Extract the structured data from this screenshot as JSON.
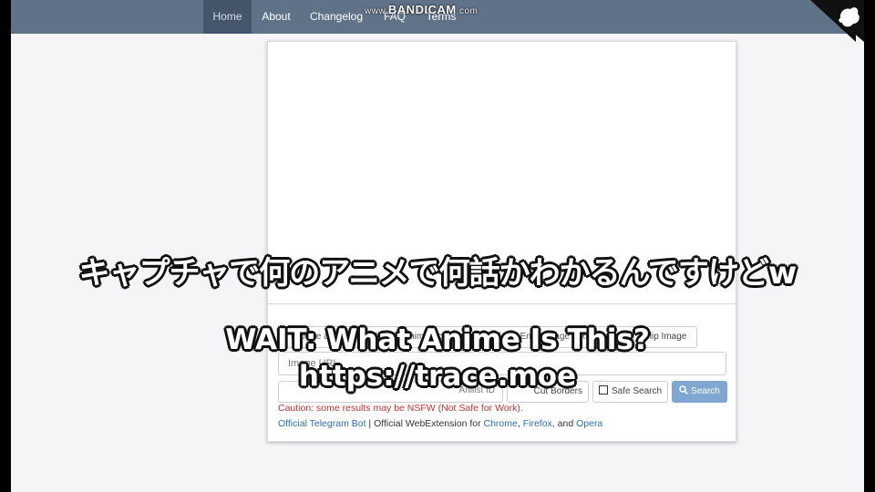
{
  "navbar": {
    "items": [
      {
        "label": "Home",
        "active": true
      },
      {
        "label": "About"
      },
      {
        "label": "Changelog"
      },
      {
        "label": "FAQ"
      },
      {
        "label": "Terms"
      }
    ]
  },
  "form": {
    "drop_button_label": "Browse a file / Drag & Drop Anime ScreenShot / Ctrl+V / Enter Image URL",
    "flip_button_label": "Flip Image",
    "url_placeholder": "Image URL",
    "anilist_placeholder": "Anilist ID",
    "cut_border_label": "Cut Borders",
    "safe_search_label": "Safe Search",
    "search_button_label": "Search"
  },
  "caution_text": "Caution: some results may be NSFW (Not Safe for Work).",
  "links": {
    "telegram": "Official Telegram Bot",
    "separator": "|",
    "extension_prefix": "Official WebExtension for",
    "chrome": "Chrome",
    "comma1": ",",
    "firefox": "Firefox",
    "comma2": ",",
    "and": "and",
    "opera": "Opera"
  },
  "overlay": {
    "watermark_prefix": "www.",
    "watermark_brand": "BANDICAM",
    "watermark_suffix": ".com",
    "subtitle_jp": "キャプチャで何のアニメで何話かわかるんですけどw",
    "subtitle_en_1": "WAIT: What Anime Is This?",
    "subtitle_en_2": "https://trace.moe"
  },
  "colors": {
    "navbar": "#5f7288",
    "search_button": "#7fa7d1",
    "caution": "#c9302c",
    "link": "#2a6fb5"
  }
}
